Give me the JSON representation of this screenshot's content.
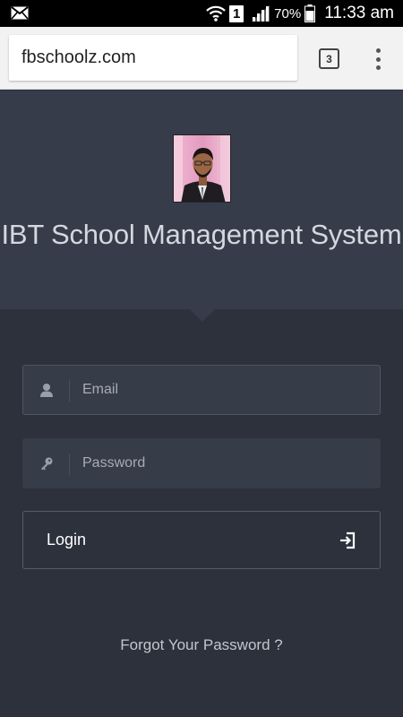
{
  "status_bar": {
    "sim": "1",
    "battery": "70%",
    "time": "11:33 am"
  },
  "browser": {
    "url": "fbschoolz.com",
    "tab_count": "3"
  },
  "page": {
    "title": "IBT School Management System",
    "email_placeholder": "Email",
    "password_placeholder": "Password",
    "login_label": "Login",
    "forgot_label": "Forgot Your Password ?"
  },
  "colors": {
    "page_bg": "#2c313c",
    "header_bg": "#363c4a",
    "field_bg": "#363c48",
    "text_light": "#d4d7de"
  },
  "icons": {
    "email_field": "user-icon",
    "password_field": "key-icon",
    "login_button": "sign-in-icon"
  }
}
